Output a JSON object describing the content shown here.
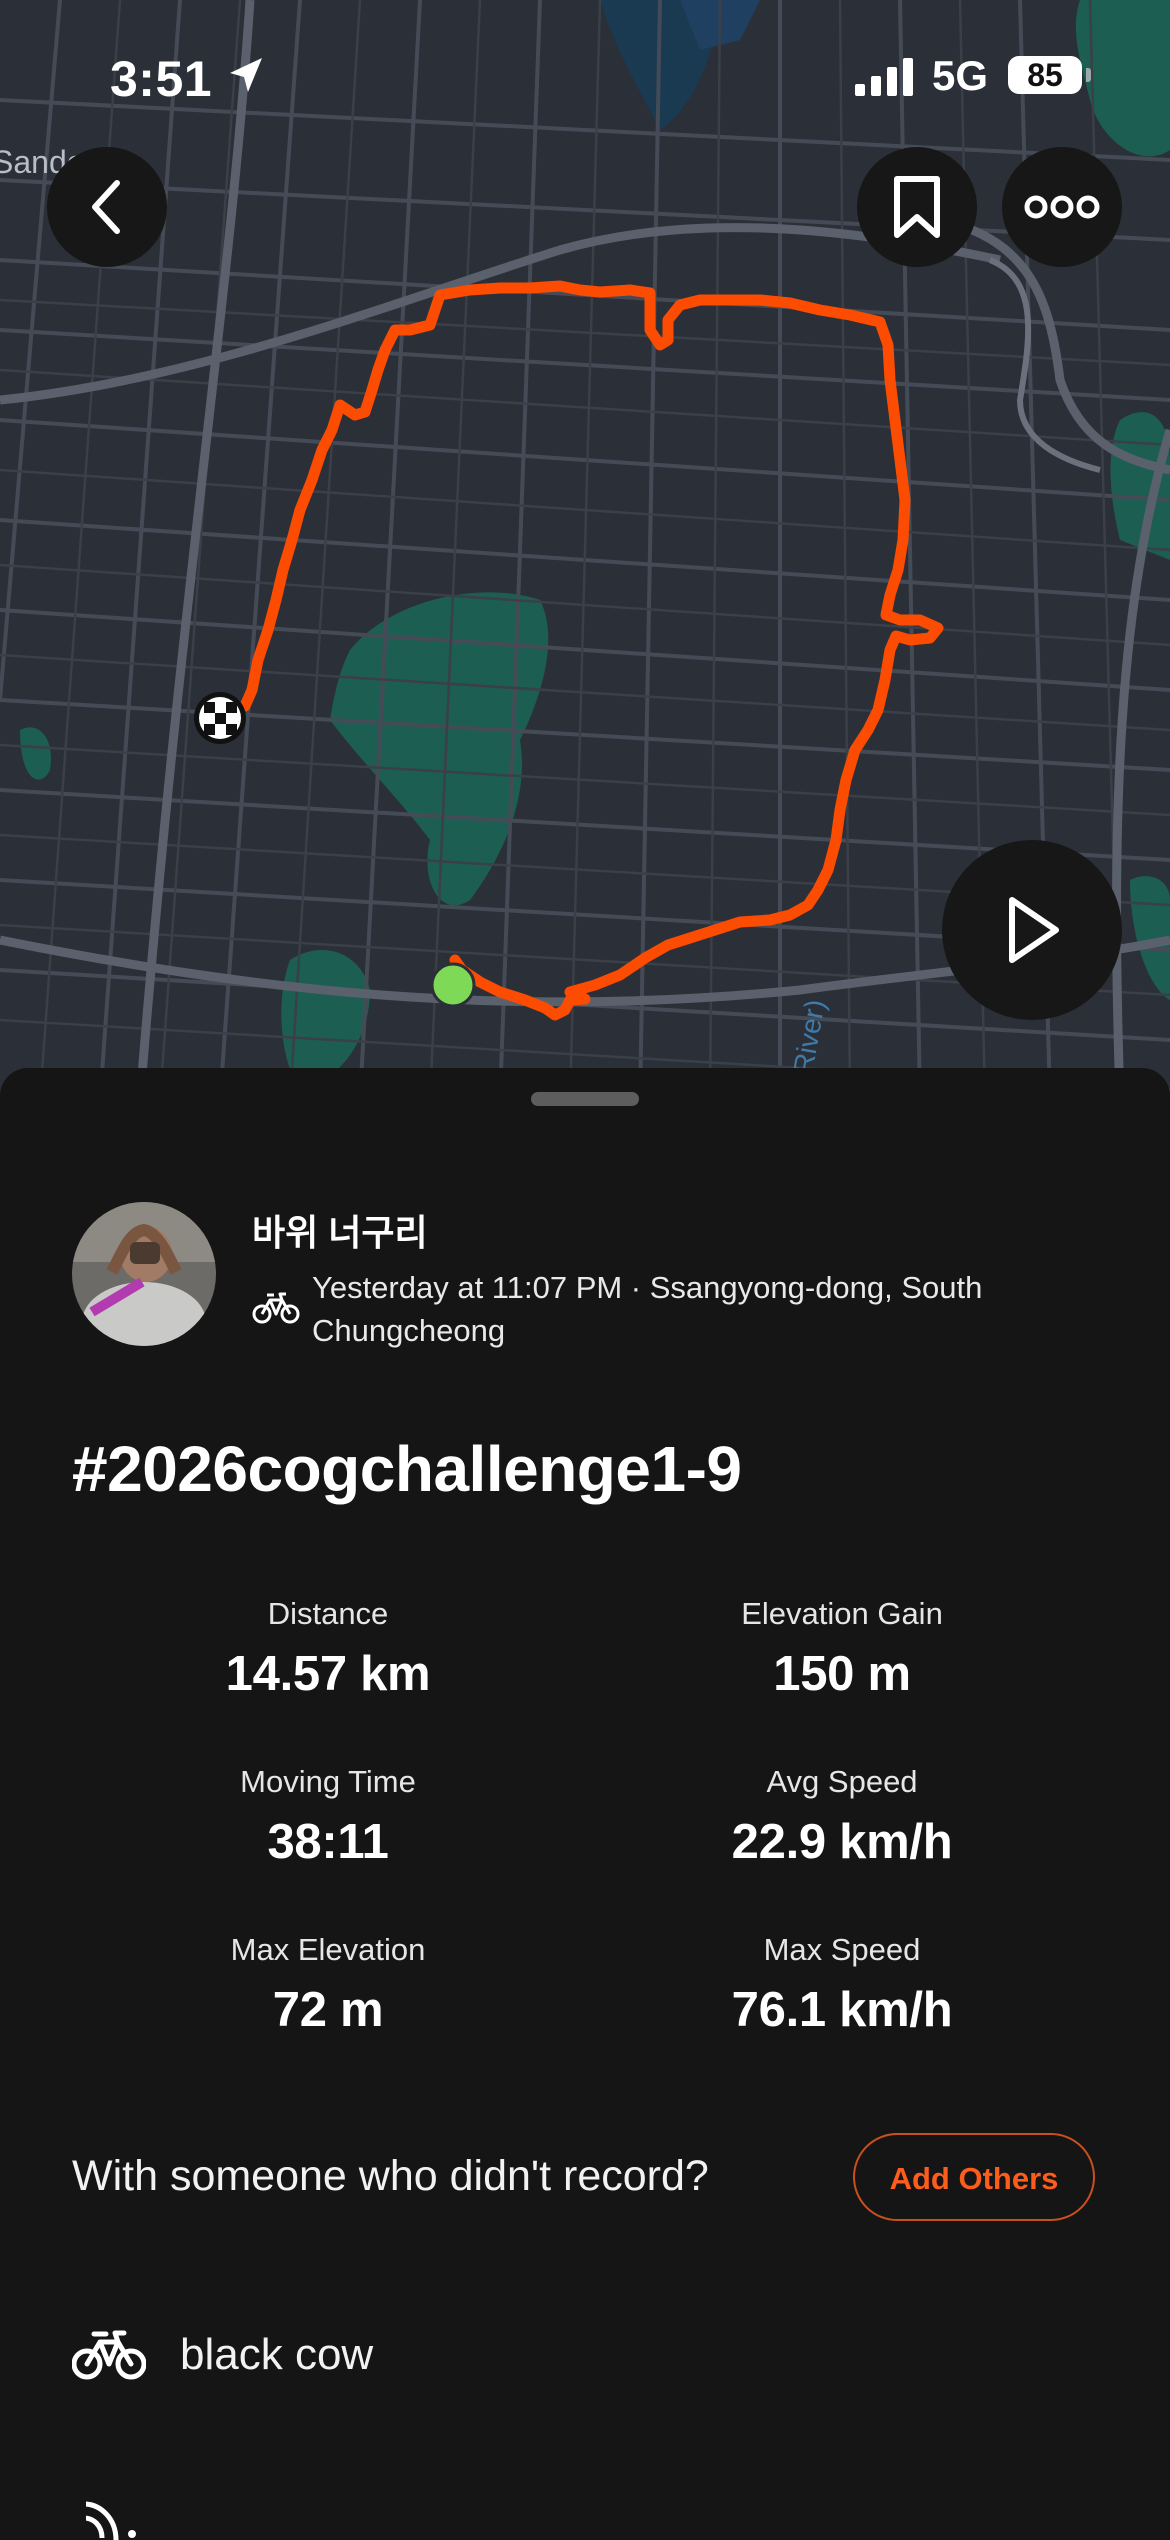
{
  "status_bar": {
    "time": "3:51",
    "network": "5G",
    "battery": "85"
  },
  "map": {
    "place_label": "Sandori",
    "river_label": "River)",
    "route_color": "#fc4c02",
    "start_color": "#7ed957"
  },
  "activity": {
    "athlete_name": "바위 너구리",
    "meta_line1": "Yesterday at 11:07 PM · Ssangyong-dong, South",
    "meta_line2": "Chungcheong",
    "title": "#2026cogchallenge1-9",
    "sport_icon": "bike-icon"
  },
  "stats": [
    {
      "label": "Distance",
      "value": "14.57 km"
    },
    {
      "label": "Elevation Gain",
      "value": "150 m"
    },
    {
      "label": "Moving Time",
      "value": "38:11"
    },
    {
      "label": "Avg Speed",
      "value": "22.9 km/h"
    },
    {
      "label": "Max Elevation",
      "value": "72 m"
    },
    {
      "label": "Max Speed",
      "value": "76.1 km/h"
    }
  ],
  "with_others": {
    "question": "With someone who didn't record?",
    "button": "Add Others"
  },
  "gear": {
    "name": "black cow"
  },
  "colors": {
    "accent": "#fc5c1c",
    "background": "#151515"
  }
}
